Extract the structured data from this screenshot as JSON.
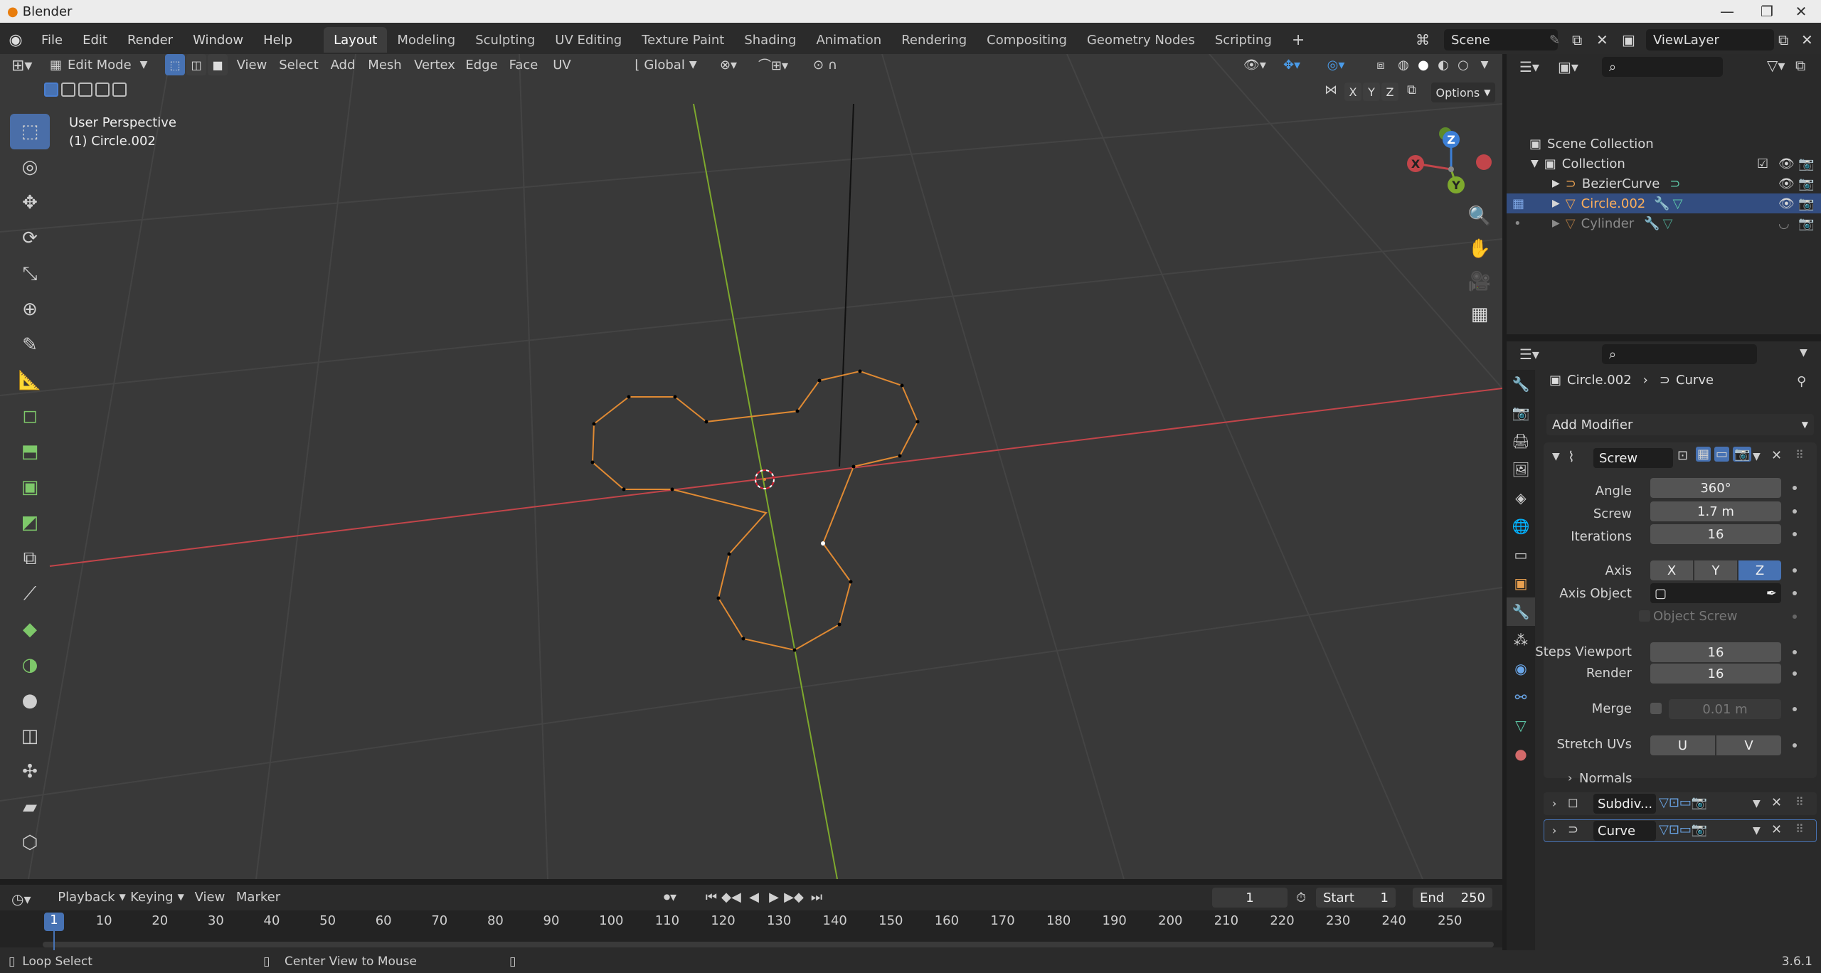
{
  "title": "Blender",
  "menus": [
    "File",
    "Edit",
    "Render",
    "Window",
    "Help"
  ],
  "workspaces": [
    "Layout",
    "Modeling",
    "Sculpting",
    "UV Editing",
    "Texture Paint",
    "Shading",
    "Animation",
    "Rendering",
    "Compositing",
    "Geometry Nodes",
    "Scripting"
  ],
  "active_workspace": "Layout",
  "scene": "Scene",
  "view_layer": "ViewLayer",
  "viewport": {
    "mode": "Edit Mode",
    "menus": [
      "View",
      "Select",
      "Add",
      "Mesh",
      "Vertex",
      "Edge",
      "Face",
      "UV"
    ],
    "orientation": "Global",
    "options": "Options",
    "axis_toggles": [
      "X",
      "Y",
      "Z"
    ],
    "overlay_text": "User Perspective",
    "overlay_object": "(1) Circle.002",
    "gizmo_labels": {
      "x": "X",
      "y": "Y",
      "z": "Z"
    }
  },
  "outliner": {
    "root": "Scene Collection",
    "collection": "Collection",
    "items": [
      {
        "name": "BezierCurve",
        "selected": false,
        "hidden": false
      },
      {
        "name": "Circle.002",
        "selected": true,
        "hidden": false
      },
      {
        "name": "Cylinder",
        "selected": false,
        "hidden": true
      }
    ]
  },
  "properties": {
    "breadcrumb_object": "Circle.002",
    "breadcrumb_modifier": "Curve",
    "add_modifier": "Add Modifier",
    "screw": {
      "name": "Screw",
      "angle_label": "Angle",
      "angle": "360°",
      "screw_label": "Screw",
      "screw": "1.7 m",
      "iterations_label": "Iterations",
      "iterations": "16",
      "axis_label": "Axis",
      "axis_options": [
        "X",
        "Y",
        "Z"
      ],
      "axis_active": "Z",
      "axis_object_label": "Axis Object",
      "object_screw_label": "Object Screw",
      "steps_viewport_label": "Steps Viewport",
      "steps_viewport": "16",
      "render_label": "Render",
      "render": "16",
      "merge_label": "Merge",
      "merge": "0.01 m",
      "stretch_uvs_label": "Stretch UVs",
      "stretch_u": "U",
      "stretch_v": "V",
      "normals_label": "Normals"
    },
    "modifiers_collapsed": [
      "Subdiv...",
      "Curve"
    ]
  },
  "timeline": {
    "menus": [
      "Playback",
      "Keying",
      "View",
      "Marker"
    ],
    "current_frame": "1",
    "start_label": "Start",
    "start": "1",
    "end_label": "End",
    "end": "250",
    "ticks": [
      "1",
      "10",
      "20",
      "30",
      "40",
      "50",
      "60",
      "70",
      "80",
      "90",
      "100",
      "110",
      "120",
      "130",
      "140",
      "150",
      "160",
      "170",
      "180",
      "190",
      "200",
      "210",
      "220",
      "230",
      "240",
      "250"
    ]
  },
  "status": {
    "left": "Loop Select",
    "middle": "Center View to Mouse",
    "version": "3.6.1"
  },
  "colors": {
    "accent": "#4772b3",
    "selected_edge": "#e08a33",
    "x_axis": "#c2454a",
    "y_axis": "#7ea92d",
    "z_axis": "#3c7fd6"
  }
}
